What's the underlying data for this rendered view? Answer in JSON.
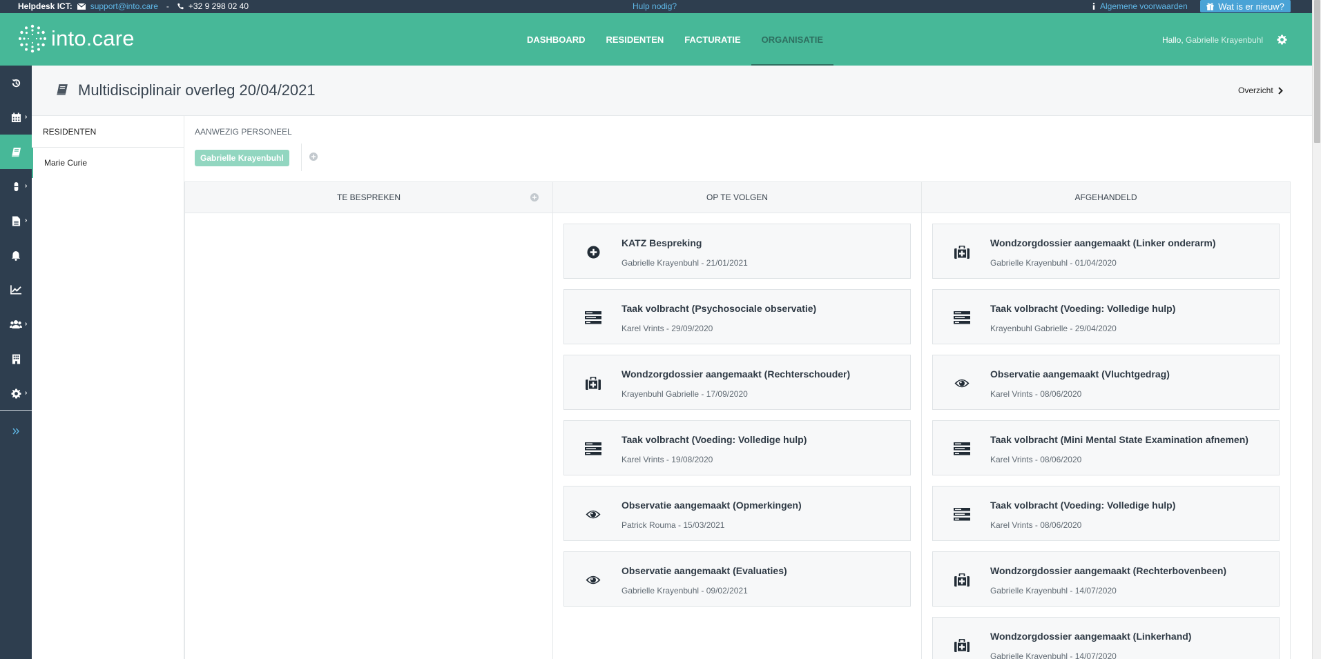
{
  "topbar": {
    "helpdesk_label": "Helpdesk ICT:",
    "email": "support@into.care",
    "separator": "-",
    "phone": "+32 9 298 02 40",
    "help_link": "Hulp nodig?",
    "terms_link": "Algemene voorwaarden",
    "whats_new_button": "Wat is er nieuw?"
  },
  "header": {
    "logo_text": "into.care",
    "nav": [
      {
        "label": "DASHBOARD"
      },
      {
        "label": "RESIDENTEN"
      },
      {
        "label": "FACTURATIE"
      },
      {
        "label": "ORGANISATIE",
        "active": true
      }
    ],
    "greeting": "Hallo,",
    "user_name": "Gabrielle Krayenbuhl"
  },
  "sidebar": {
    "items": [
      {
        "icon": "history-icon"
      },
      {
        "icon": "calendar-icon",
        "has_submenu": true
      },
      {
        "icon": "book-icon",
        "active": true
      },
      {
        "icon": "pill-icon",
        "has_submenu": true
      },
      {
        "icon": "file-icon",
        "has_submenu": true
      },
      {
        "icon": "bell-icon"
      },
      {
        "icon": "chart-line-icon"
      },
      {
        "icon": "users-icon",
        "has_submenu": true
      },
      {
        "icon": "building-icon"
      },
      {
        "icon": "gear-icon",
        "has_submenu": true
      }
    ],
    "expand_icon": "double-chevron-right-icon"
  },
  "page": {
    "title": "Multidisciplinair overleg 20/04/2021",
    "overview_link": "Overzicht"
  },
  "residents_panel": {
    "header": "RESIDENTEN",
    "items": [
      "Marie Curie"
    ]
  },
  "staff": {
    "label": "AANWEZIG PERSONEEL",
    "members": [
      "Gabrielle Krayenbuhl"
    ]
  },
  "columns": [
    {
      "title": "TE BESPREKEN",
      "cards": []
    },
    {
      "title": "OP TE VOLGEN",
      "cards": [
        {
          "icon": "plus-circle-icon",
          "title": "KATZ Bespreking",
          "meta": "Gabrielle Krayenbuhl - 21/01/2021"
        },
        {
          "icon": "tasks-icon",
          "title": "Taak volbracht (Psychosociale observatie)",
          "meta": "Karel Vrints - 29/09/2020"
        },
        {
          "icon": "medkit-icon",
          "title": "Wondzorgdossier aangemaakt (Rechterschouder)",
          "meta": "Krayenbuhl Gabrielle - 17/09/2020"
        },
        {
          "icon": "tasks-icon",
          "title": "Taak volbracht (Voeding: Volledige hulp)",
          "meta": "Karel Vrints - 19/08/2020"
        },
        {
          "icon": "eye-icon",
          "title": "Observatie aangemaakt (Opmerkingen)",
          "meta": "Patrick Rouma - 15/03/2021"
        },
        {
          "icon": "eye-icon",
          "title": "Observatie aangemaakt (Evaluaties)",
          "meta": "Gabrielle Krayenbuhl - 09/02/2021"
        }
      ]
    },
    {
      "title": "AFGEHANDELD",
      "cards": [
        {
          "icon": "medkit-icon",
          "title": "Wondzorgdossier aangemaakt (Linker onderarm)",
          "meta": "Gabrielle Krayenbuhl - 01/04/2020"
        },
        {
          "icon": "tasks-icon",
          "title": "Taak volbracht (Voeding: Volledige hulp)",
          "meta": "Krayenbuhl Gabrielle - 29/04/2020"
        },
        {
          "icon": "eye-icon",
          "title": "Observatie aangemaakt (Vluchtgedrag)",
          "meta": "Karel Vrints - 08/06/2020"
        },
        {
          "icon": "tasks-icon",
          "title": "Taak volbracht (Mini Mental State Examination afnemen)",
          "meta": "Karel Vrints - 08/06/2020"
        },
        {
          "icon": "tasks-icon",
          "title": "Taak volbracht (Voeding: Volledige hulp)",
          "meta": "Karel Vrints - 08/06/2020"
        },
        {
          "icon": "medkit-icon",
          "title": "Wondzorgdossier aangemaakt (Rechterbovenbeen)",
          "meta": "Gabrielle Krayenbuhl - 14/07/2020"
        },
        {
          "icon": "medkit-icon",
          "title": "Wondzorgdossier aangemaakt (Linkerhand)",
          "meta": "Gabrielle Krayenbuhl - 14/07/2020"
        }
      ]
    }
  ],
  "colors": {
    "brand_green": "#47b898",
    "dark_navy": "#2e3e4f",
    "link_blue": "#5fb7e6",
    "button_blue": "#4aa3d6"
  }
}
